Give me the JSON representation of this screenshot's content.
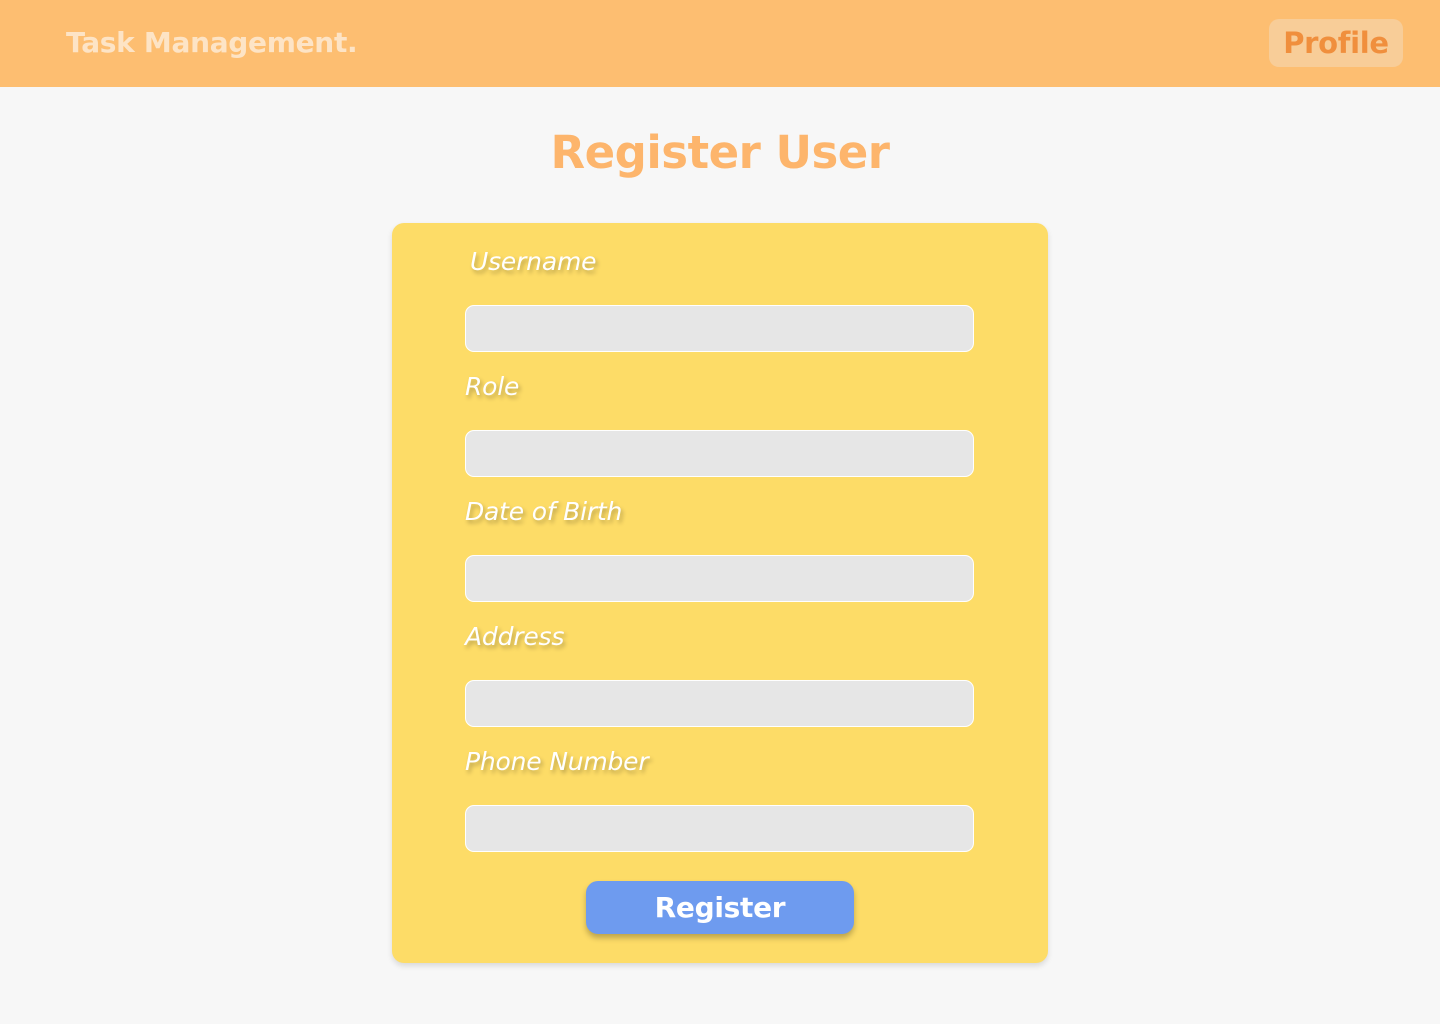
{
  "header": {
    "brand": "Task Management.",
    "profile_label": "Profile"
  },
  "page": {
    "title": "Register User"
  },
  "form": {
    "fields": [
      {
        "label": "Username",
        "value": ""
      },
      {
        "label": "Role",
        "value": ""
      },
      {
        "label": "Date of Birth",
        "value": ""
      },
      {
        "label": "Address",
        "value": ""
      },
      {
        "label": "Phone Number",
        "value": ""
      }
    ],
    "submit_label": "Register"
  },
  "colors": {
    "header_bg": "#fdbe71",
    "brand_text": "#fde4c6",
    "profile_bg": "#f8cd98",
    "profile_text": "#f08f3d",
    "title": "#fdb56c",
    "card_bg": "#fddc67",
    "input_bg": "#e6e6e6",
    "button_bg": "#6e9bef",
    "page_bg": "#f7f7f7"
  }
}
